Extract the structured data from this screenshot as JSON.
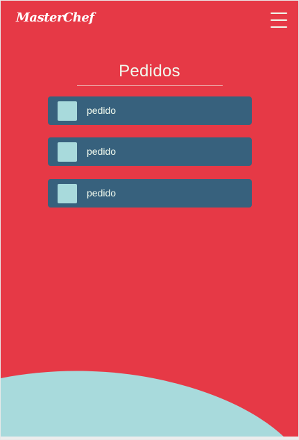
{
  "header": {
    "logo_text": "MasterChef",
    "menu_icon": "hamburger-menu-icon"
  },
  "page": {
    "title": "Pedidos"
  },
  "orders": [
    {
      "label": "pedido",
      "checked": false
    },
    {
      "label": "pedido",
      "checked": false
    },
    {
      "label": "pedido",
      "checked": false
    }
  ],
  "colors": {
    "background": "#e63946",
    "card": "#37617d",
    "accent": "#a8dadc",
    "text": "#f1faee"
  }
}
